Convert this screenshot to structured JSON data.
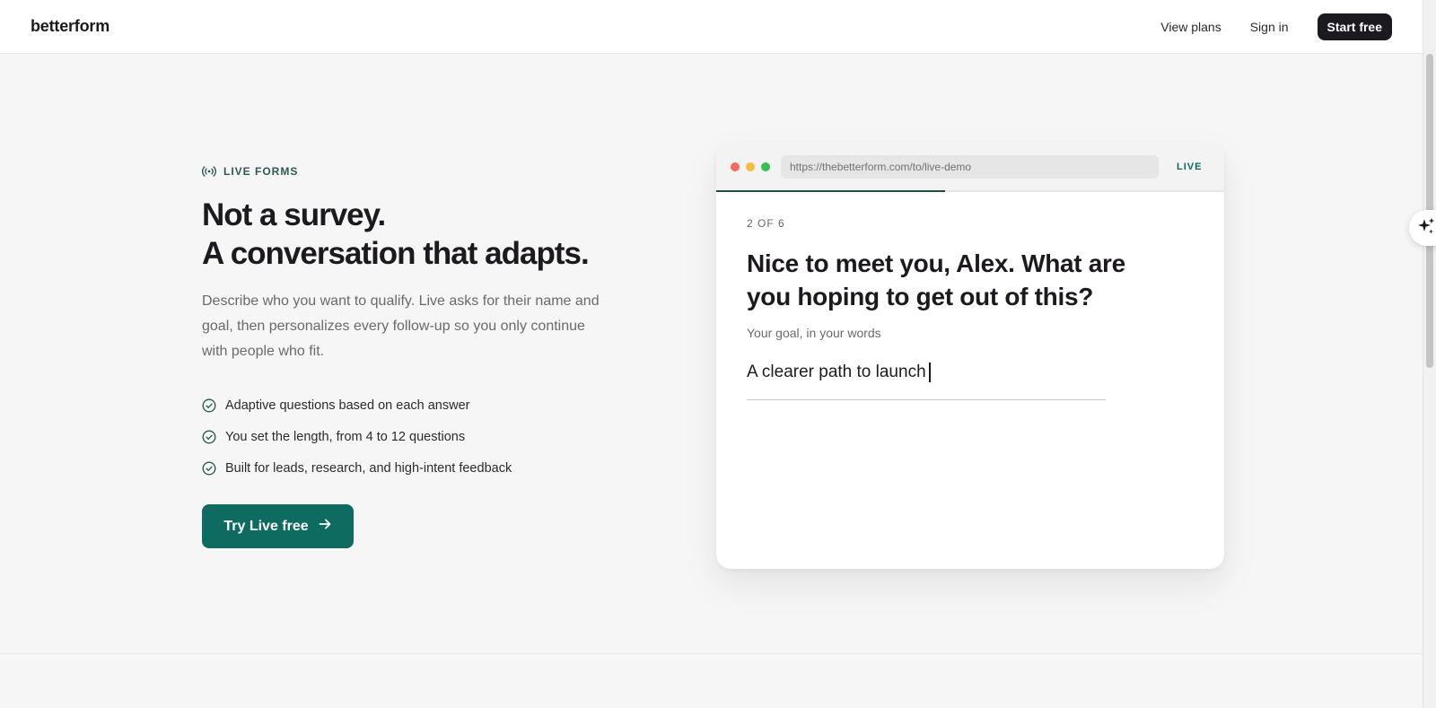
{
  "header": {
    "brand": "betterform",
    "nav": {
      "view_plans": "View plans",
      "sign_in": "Sign in",
      "start_free": "Start free"
    }
  },
  "hero": {
    "eyebrow": "LIVE FORMS",
    "headline_line1": "Not a survey.",
    "headline_line2": "A conversation that adapts.",
    "subtext": "Describe who you want to qualify. Live asks for their name and goal, then personalizes every follow-up so you only continue with people who fit.",
    "features": [
      "Adaptive questions based on each answer",
      "You set the length, from 4 to 12 questions",
      "Built for leads, research, and high-intent feedback"
    ],
    "cta_label": "Try Live free"
  },
  "demo": {
    "url": "https://thebetterform.com/to/live-demo",
    "badge": "LIVE",
    "progress_fraction": 0.45,
    "step": "2 OF 6",
    "question": "Nice to meet you, Alex. What are you hoping to get out of this?",
    "hint": "Your goal, in your words",
    "answer": "A clearer path to launch"
  },
  "colors": {
    "accent": "#0e6b5f",
    "dark": "#1d1a1f",
    "dot_red": "#f26a5e",
    "dot_yellow": "#f6bd3b",
    "dot_green": "#35c24b"
  },
  "icons": {
    "eyebrow": "broadcast-icon",
    "feature": "check-circle-icon",
    "cta": "arrow-right-icon",
    "assistant": "sparkle-icon"
  }
}
